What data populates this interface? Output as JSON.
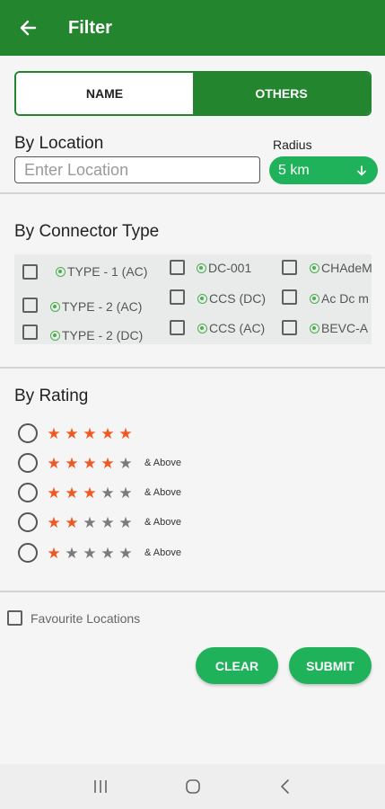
{
  "header": {
    "title": "Filter",
    "back_icon": "arrow-left-icon",
    "bg_color": "#23862f"
  },
  "tabs": [
    {
      "label": "NAME",
      "active": false
    },
    {
      "label": "OTHERS",
      "active": true
    }
  ],
  "location": {
    "title": "By Location",
    "placeholder": "Enter Location",
    "value": "",
    "radius_label": "Radius",
    "radius_value": "5 km",
    "radius_icon": "arrow-down-icon"
  },
  "connector": {
    "title": "By Connector Type",
    "items": [
      {
        "label": "TYPE - 1 (AC)",
        "checked": false
      },
      {
        "label": "TYPE - 2 (AC)",
        "checked": false
      },
      {
        "label": "TYPE - 2 (DC)",
        "checked": false
      },
      {
        "label": "DC-001",
        "checked": false
      },
      {
        "label": "CCS (DC)",
        "checked": false
      },
      {
        "label": "CCS (AC)",
        "checked": false
      },
      {
        "label": "CHAdeM",
        "checked": false
      },
      {
        "label": "Ac Dc m",
        "checked": false
      },
      {
        "label": "BEVC-A",
        "checked": false
      }
    ]
  },
  "rating": {
    "title": "By Rating",
    "above_label": "& Above",
    "options": [
      {
        "stars": 5,
        "selected": false
      },
      {
        "stars": 4,
        "selected": false
      },
      {
        "stars": 3,
        "selected": false
      },
      {
        "stars": 2,
        "selected": false
      },
      {
        "stars": 1,
        "selected": false
      }
    ],
    "star_on_color": "#f05822",
    "star_off_color": "#7b7b7b"
  },
  "favourite": {
    "label": "Favourite Locations",
    "checked": false
  },
  "actions": {
    "clear_label": "CLEAR",
    "submit_label": "SUBMIT",
    "button_color": "#1fb25a"
  },
  "navbar": {
    "icons": [
      "recent-apps-icon",
      "home-icon",
      "back-icon"
    ]
  }
}
